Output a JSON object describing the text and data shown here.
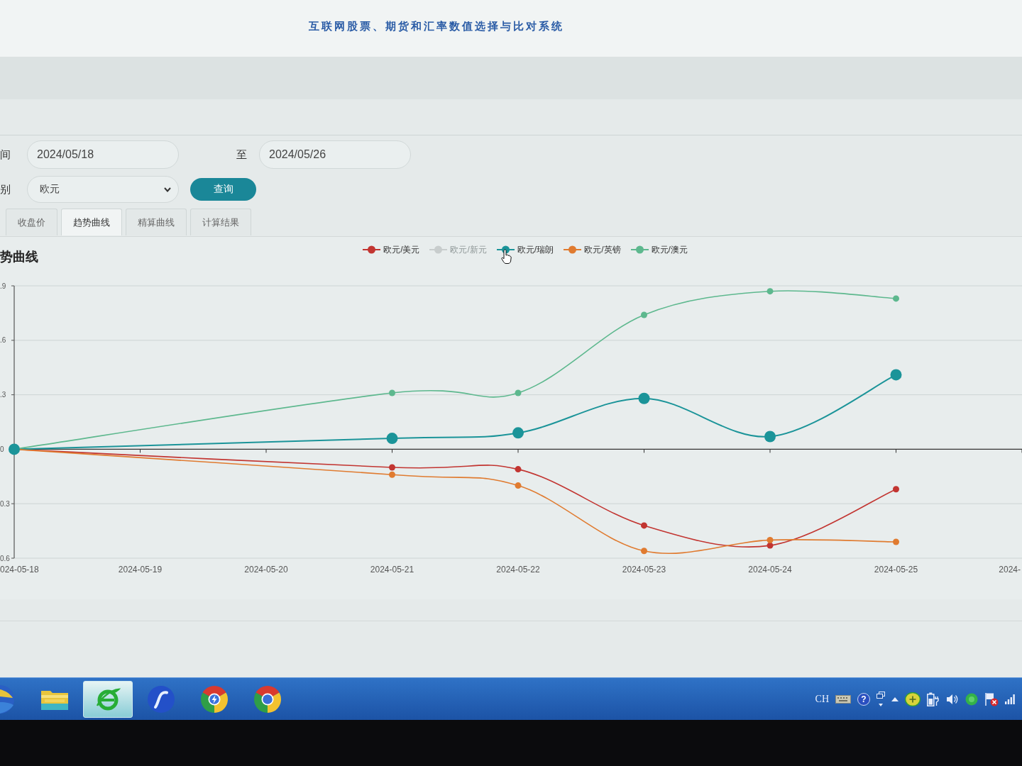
{
  "header": {
    "title": "互联网股票、期货和汇率数值选择与比对系统"
  },
  "filters": {
    "date_label": "间",
    "date_from": "2024/05/18",
    "range_separator": "至",
    "date_to": "2024/05/26",
    "category_label": "别",
    "category": "欧元",
    "query_button": "查询"
  },
  "tabs": [
    {
      "label": "收盘价",
      "selected": false
    },
    {
      "label": "趋势曲线",
      "selected": true
    },
    {
      "label": "精算曲线",
      "selected": false
    },
    {
      "label": "计算结果",
      "selected": false
    }
  ],
  "chart": {
    "legend_state": [
      {
        "on": true,
        "hovered": false
      },
      {
        "on": false,
        "hovered": false
      },
      {
        "on": true,
        "hovered": true
      },
      {
        "on": true,
        "hovered": false
      },
      {
        "on": true,
        "hovered": false
      }
    ],
    "x_axis_start_label": "024-05-18",
    "chart_data": [
      {
        "type": "line",
        "title": "势曲线",
        "x": [
          "2024-05-18",
          "2024-05-21",
          "2024-05-22",
          "2024-05-23",
          "2024-05-24",
          "2024-05-25"
        ],
        "series": [
          {
            "name": "欧元/美元",
            "color": "#c23531",
            "values": [
              0,
              -0.1,
              -0.11,
              -0.42,
              -0.53,
              -0.22
            ]
          },
          {
            "name": "欧元/新元",
            "color": "#c8cdcd",
            "values": [
              null,
              null,
              null,
              null,
              null,
              null
            ]
          },
          {
            "name": "欧元/瑞朗",
            "color": "#1b9499",
            "values": [
              0,
              0.06,
              0.09,
              0.28,
              0.07,
              0.41
            ]
          },
          {
            "name": "欧元/英镑",
            "color": "#e07b30",
            "values": [
              0,
              -0.14,
              -0.2,
              -0.56,
              -0.5,
              -0.51
            ]
          },
          {
            "name": "欧元/澳元",
            "color": "#5db88e",
            "values": [
              0,
              0.31,
              0.31,
              0.74,
              0.87,
              0.83
            ]
          }
        ],
        "xlim": [
          "2024-05-18",
          "2024-05-26"
        ],
        "ylim": [
          -0.6,
          0.9
        ],
        "xticks": [
          "2024-05-19",
          "2024-05-20",
          "2024-05-21",
          "2024-05-22",
          "2024-05-23",
          "2024-05-24",
          "2024-05-25",
          {
            "value": "2024-05-26",
            "label": "2024-"
          }
        ],
        "yticks": [
          {
            "value": 0.9,
            "label": ".9"
          },
          {
            "value": 0.6,
            "label": ".6"
          },
          {
            "value": 0.3,
            "label": ".3"
          },
          {
            "value": 0,
            "label": "0"
          },
          {
            "value": -0.3,
            "label": "0.3"
          },
          {
            "value": -0.6,
            "label": "0.6"
          }
        ],
        "grid": true,
        "legend": "top",
        "marker": "circle"
      }
    ]
  },
  "taskbar": {
    "apps": [
      {
        "kind": "folder",
        "selected": false
      },
      {
        "kind": "ring",
        "selected": true
      },
      {
        "kind": "swoosh",
        "selected": false
      },
      {
        "kind": "bolt-wheel",
        "selected": false
      },
      {
        "kind": "wheel",
        "selected": false
      }
    ],
    "language": "CH",
    "help": "?"
  }
}
